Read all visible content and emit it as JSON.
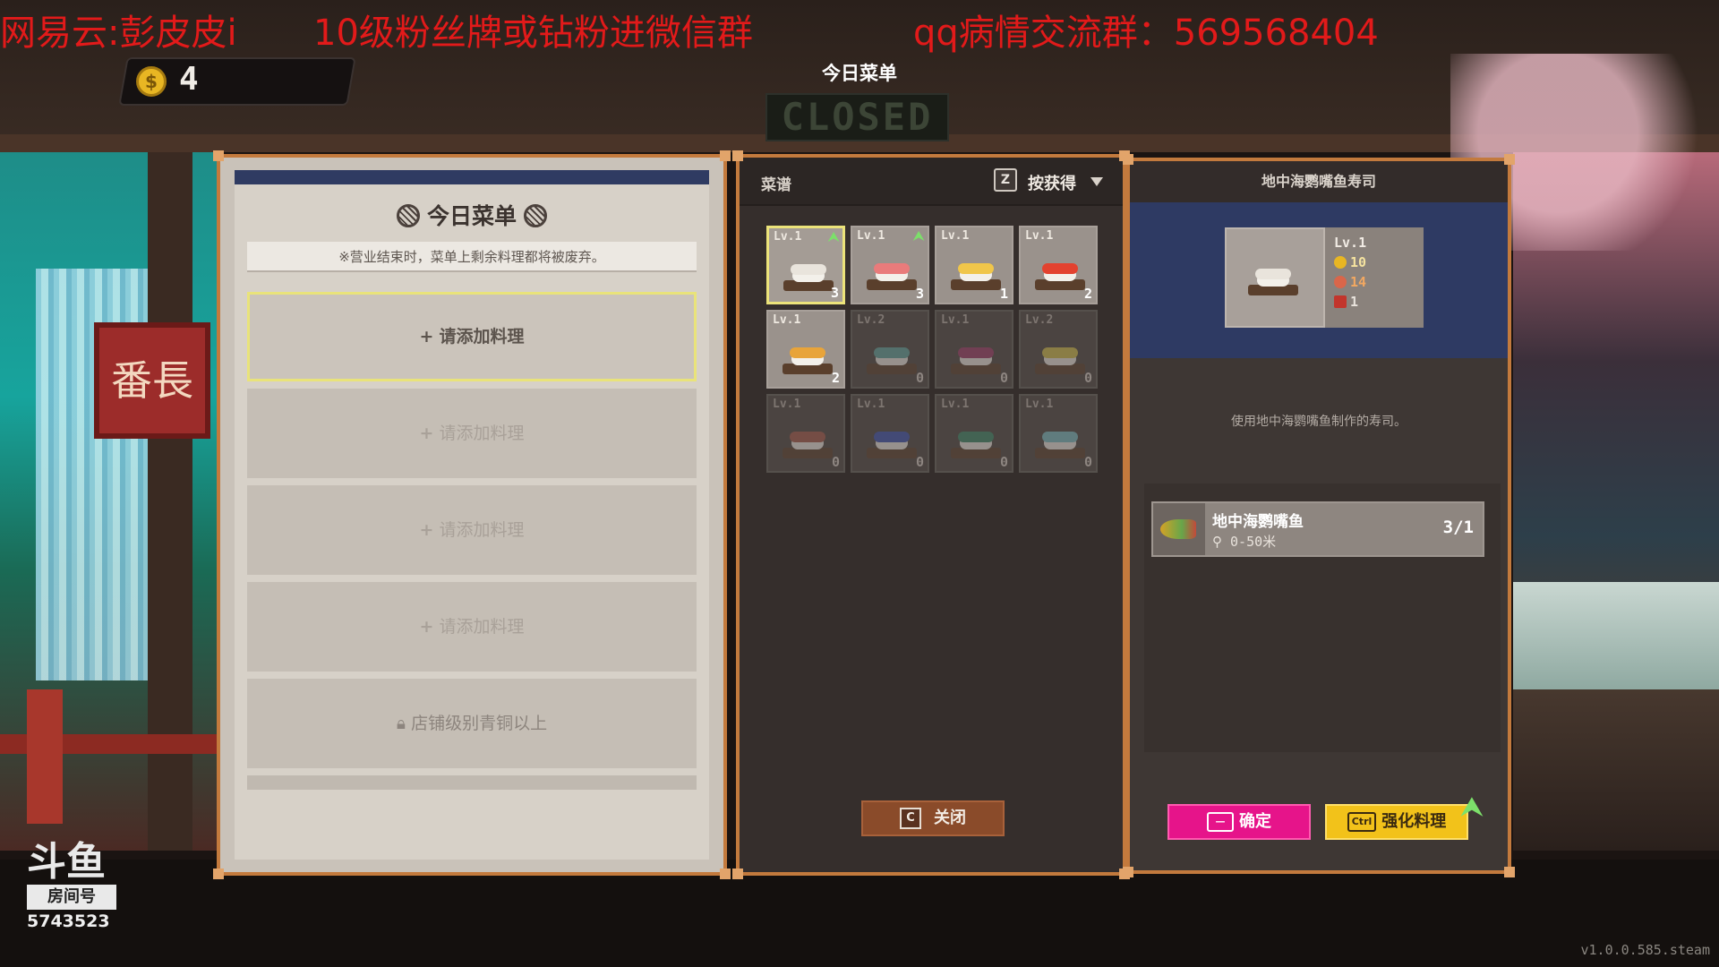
{
  "overlay": {
    "line1": "网易云:彭皮皮i",
    "line2": "10级粉丝牌或钻粉进微信群",
    "line3": "qq病情交流群：569568404"
  },
  "coins": {
    "icon": "coin-icon",
    "symbol": "$",
    "value": "4"
  },
  "header": {
    "title": "今日菜单",
    "closed_sign": "CLOSED"
  },
  "menu": {
    "title": "今日菜单",
    "note": "※营业结束时，菜单上剩余料理都将被废弃。",
    "slots": [
      {
        "label": "请添加料理",
        "plus": "+"
      },
      {
        "label": "请添加料理",
        "plus": "+"
      },
      {
        "label": "请添加料理",
        "plus": "+"
      },
      {
        "label": "请添加料理",
        "plus": "+"
      }
    ],
    "locked_slot": {
      "icon": "lock-icon",
      "label": "店铺级别青铜以上"
    }
  },
  "recipes": {
    "title": "菜谱",
    "sort_key": "Z",
    "sort_label": "按获得",
    "items": [
      {
        "level": "Lv.1",
        "count": "3",
        "owned": true,
        "selected": true,
        "upgrade": true,
        "topping": "#e9e4dc"
      },
      {
        "level": "Lv.1",
        "count": "3",
        "owned": true,
        "selected": false,
        "upgrade": true,
        "topping": "#e97b7b"
      },
      {
        "level": "Lv.1",
        "count": "1",
        "owned": true,
        "selected": false,
        "upgrade": false,
        "topping": "#f0c64a"
      },
      {
        "level": "Lv.1",
        "count": "2",
        "owned": true,
        "selected": false,
        "upgrade": false,
        "topping": "#e3422f"
      },
      {
        "level": "Lv.1",
        "count": "2",
        "owned": true,
        "selected": false,
        "upgrade": false,
        "topping": "#e8a43a"
      },
      {
        "level": "Lv.2",
        "count": "0",
        "owned": false,
        "selected": false,
        "upgrade": false,
        "topping": "#5fa7a0"
      },
      {
        "level": "Lv.1",
        "count": "0",
        "owned": false,
        "selected": false,
        "upgrade": false,
        "topping": "#a03a6a"
      },
      {
        "level": "Lv.2",
        "count": "0",
        "owned": false,
        "selected": false,
        "upgrade": false,
        "topping": "#d8c24a"
      },
      {
        "level": "Lv.1",
        "count": "0",
        "owned": false,
        "selected": false,
        "upgrade": false,
        "topping": "#a85a4a"
      },
      {
        "level": "Lv.1",
        "count": "0",
        "owned": false,
        "selected": false,
        "upgrade": false,
        "topping": "#3a52b8"
      },
      {
        "level": "Lv.1",
        "count": "0",
        "owned": false,
        "selected": false,
        "upgrade": false,
        "topping": "#3a8a6a"
      },
      {
        "level": "Lv.1",
        "count": "0",
        "owned": false,
        "selected": false,
        "upgrade": false,
        "topping": "#7ac0c8"
      }
    ],
    "close_key": "C",
    "close_label": "关闭"
  },
  "detail": {
    "title": "地中海鹦嘴鱼寿司",
    "level": "Lv.1",
    "price": "10",
    "taste": "14",
    "quantity": "1",
    "description": "使用地中海鹦嘴鱼制作的寿司。",
    "ingredient": {
      "name": "地中海鹦嘴鱼",
      "depth": "0-50米",
      "ratio": "3/1"
    },
    "confirm_label": "确定",
    "enhance_key": "Ctrl",
    "enhance_label": "强化料理"
  },
  "douyu": {
    "logo": "斗鱼",
    "room_label": "房间号",
    "room_number": "5743523"
  },
  "version": "v1.0.0.585.steam"
}
